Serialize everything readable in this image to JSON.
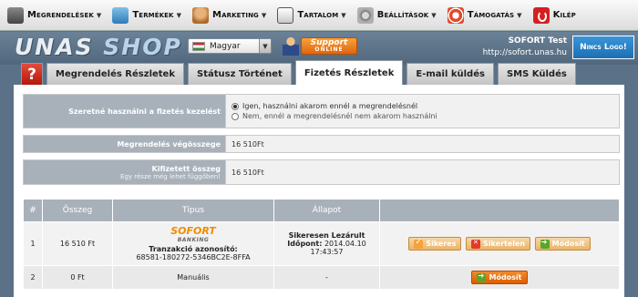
{
  "menu": {
    "items": [
      {
        "label": "Megrendelések",
        "icon": "orders-icon"
      },
      {
        "label": "Termékek",
        "icon": "products-icon"
      },
      {
        "label": "Marketing",
        "icon": "marketing-icon"
      },
      {
        "label": "Tartalom",
        "icon": "content-icon"
      },
      {
        "label": "Beállítások",
        "icon": "settings-icon"
      },
      {
        "label": "Támogatás",
        "icon": "support-icon"
      },
      {
        "label": "Kilép",
        "icon": "exit-icon"
      }
    ]
  },
  "header": {
    "logo_part1": "UNAS",
    "logo_part2": "SHOP",
    "language": "Magyar",
    "support_label": "Support",
    "support_sub": "ONLINE",
    "account_name": "SOFORT Test",
    "account_url": "http://sofort.unas.hu",
    "no_logo_label": "Nincs Logo!"
  },
  "tabs": {
    "help": "?",
    "items": [
      {
        "label": "Megrendelés Részletek"
      },
      {
        "label": "Státusz Történet"
      },
      {
        "label": "Fizetés Részletek"
      },
      {
        "label": "E-mail küldés"
      },
      {
        "label": "SMS Küldés"
      }
    ]
  },
  "form": {
    "manager_label": "Szeretné használni a fizetés kezelést",
    "manager_yes": "Igen, használni akarom ennél a megrendelésnél",
    "manager_no": "Nem, ennél a megrendelésnél nem akarom használni",
    "total_label": "Megrendelés végösszege",
    "total_value": "16 510Ft",
    "paid_label": "Kifizetett összeg",
    "paid_sub": "Egy része még lehet függőben!",
    "paid_value": "16 510Ft"
  },
  "payments": {
    "headers": [
      "#",
      "Összeg",
      "Típus",
      "Állapot",
      ""
    ],
    "rows": [
      {
        "num": "1",
        "amount": "16 510 Ft",
        "provider": "SOFORT",
        "provider_sub": "BANKING",
        "tid_label": "Tranzakció azonosító:",
        "tid": "68581-180272-5346BC2E-8FFA",
        "status": "Sikeresen Lezárult",
        "time_label": "Időpont:",
        "time": "2014.04.10 17:43:57",
        "btn_success": "Sikeres",
        "btn_fail": "Sikertelen",
        "btn_modify": "Módosít"
      },
      {
        "num": "2",
        "amount": "0 Ft",
        "type": "Manuális",
        "status": "-",
        "btn_modify": "Módosít"
      }
    ]
  }
}
